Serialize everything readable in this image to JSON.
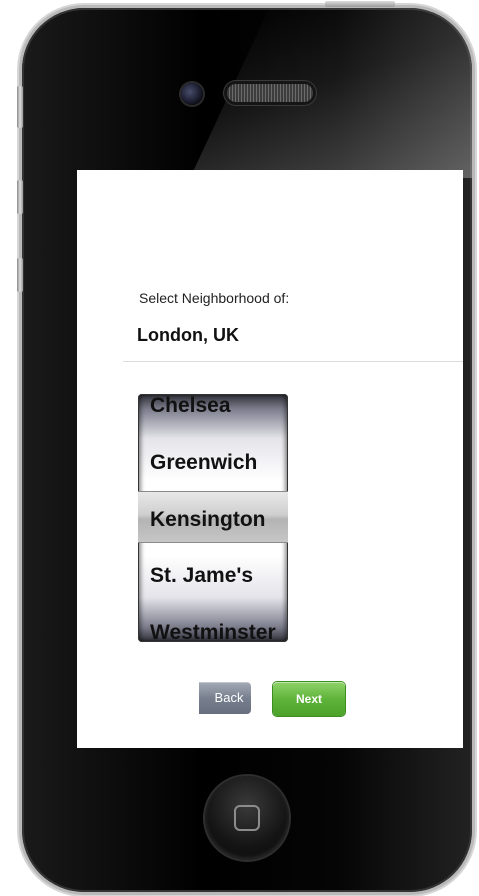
{
  "screen": {
    "prompt_label": "Select Neighborhood of:",
    "city": "London, UK"
  },
  "picker": {
    "items": [
      "Chelsea",
      "Greenwich",
      "Kensington",
      "St. Jame's",
      "Westminster"
    ],
    "selected": "Kensington"
  },
  "buttons": {
    "back_label": "Back",
    "next_label": "Next"
  },
  "colors": {
    "next_button": "#5fb43a",
    "back_button": "#78808f",
    "phone_body": "#000000"
  }
}
